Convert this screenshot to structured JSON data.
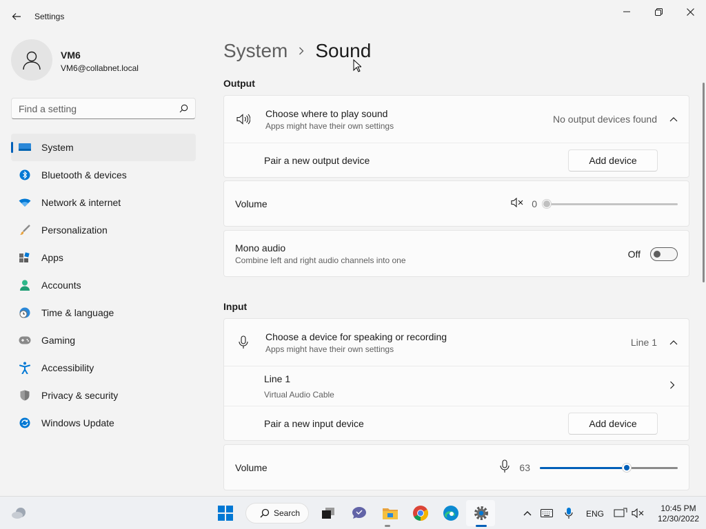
{
  "window": {
    "title": "Settings"
  },
  "profile": {
    "name": "VM6",
    "email": "VM6@collabnet.local"
  },
  "search": {
    "placeholder": "Find a setting"
  },
  "sidebar": {
    "items": [
      {
        "label": "System",
        "icon": "system-icon",
        "active": true
      },
      {
        "label": "Bluetooth & devices",
        "icon": "bluetooth-icon"
      },
      {
        "label": "Network & internet",
        "icon": "wifi-icon"
      },
      {
        "label": "Personalization",
        "icon": "brush-icon"
      },
      {
        "label": "Apps",
        "icon": "apps-icon"
      },
      {
        "label": "Accounts",
        "icon": "person-icon"
      },
      {
        "label": "Time & language",
        "icon": "clock-globe-icon"
      },
      {
        "label": "Gaming",
        "icon": "gamepad-icon"
      },
      {
        "label": "Accessibility",
        "icon": "accessibility-icon"
      },
      {
        "label": "Privacy & security",
        "icon": "shield-icon"
      },
      {
        "label": "Windows Update",
        "icon": "update-icon"
      }
    ]
  },
  "breadcrumb": {
    "parent": "System",
    "current": "Sound"
  },
  "output": {
    "section_label": "Output",
    "choose_title": "Choose where to play sound",
    "choose_sub": "Apps might have their own settings",
    "choose_status": "No output devices found",
    "pair_label": "Pair a new output device",
    "add_button": "Add device",
    "volume_label": "Volume",
    "volume_value": "0",
    "volume_level": 0,
    "mono_title": "Mono audio",
    "mono_sub": "Combine left and right audio channels into one",
    "mono_state": "Off"
  },
  "input": {
    "section_label": "Input",
    "choose_title": "Choose a device for speaking or recording",
    "choose_sub": "Apps might have their own settings",
    "choose_status": "Line 1",
    "device_name": "Line 1",
    "device_sub": "Virtual Audio Cable",
    "pair_label": "Pair a new input device",
    "add_button": "Add device",
    "volume_label": "Volume",
    "volume_value": "63",
    "volume_level": 63
  },
  "taskbar": {
    "search_label": "Search",
    "language": "ENG",
    "time": "10:45 PM",
    "date": "12/30/2022"
  },
  "colors": {
    "accent": "#005fb8",
    "background": "#f3f3f3",
    "card": "#fbfbfb"
  }
}
